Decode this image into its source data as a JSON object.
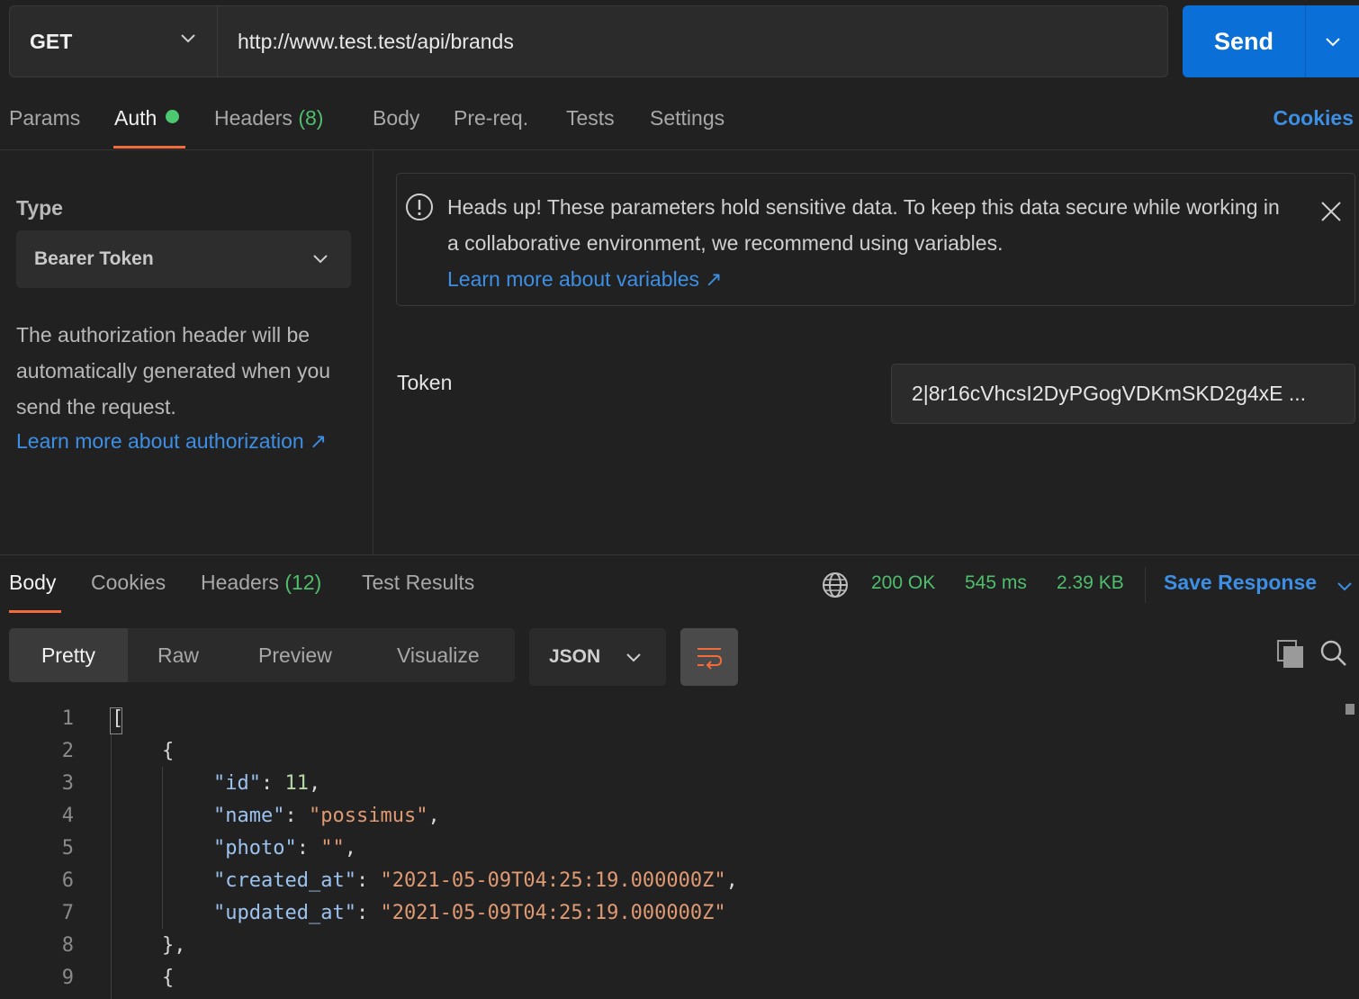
{
  "request": {
    "method": "GET",
    "url": "http://www.test.test/api/brands",
    "send_label": "Send"
  },
  "request_tabs": {
    "params": "Params",
    "auth": "Auth",
    "headers": "Headers",
    "headers_count": "(8)",
    "body": "Body",
    "prereq": "Pre-req.",
    "tests": "Tests",
    "settings": "Settings",
    "cookies": "Cookies"
  },
  "auth": {
    "type_label": "Type",
    "type_value": "Bearer Token",
    "description": "The authorization header will be automatically generated when you send the request.",
    "learn_more": "Learn more about authorization ↗",
    "warning_text": "Heads up! These parameters hold sensitive data. To keep this data secure while working in a collaborative environment, we recommend using variables.",
    "warning_link": "Learn more about variables ↗",
    "token_label": "Token",
    "token_value": "2|8r16cVhcsI2DyPGogVDKmSKD2g4xE ..."
  },
  "response_tabs": {
    "body": "Body",
    "cookies": "Cookies",
    "headers": "Headers",
    "headers_count": "(12)",
    "test_results": "Test Results",
    "status": "200 OK",
    "time": "545 ms",
    "size": "2.39 KB",
    "save_response": "Save Response"
  },
  "view": {
    "pretty": "Pretty",
    "raw": "Raw",
    "preview": "Preview",
    "visualize": "Visualize",
    "format": "JSON"
  },
  "code": {
    "line_numbers": [
      "1",
      "2",
      "3",
      "4",
      "5",
      "6",
      "7",
      "8",
      "9"
    ],
    "lines": {
      "l1": "[",
      "l2": "{",
      "id_key": "\"id\"",
      "id_val": "11",
      "name_key": "\"name\"",
      "name_val": "\"possimus\"",
      "photo_key": "\"photo\"",
      "photo_val": "\"\"",
      "created_key": "\"created_at\"",
      "created_val": "\"2021-05-09T04:25:19.000000Z\"",
      "updated_key": "\"updated_at\"",
      "updated_val": "\"2021-05-09T04:25:19.000000Z\"",
      "l8": "},",
      "l9": "{"
    }
  },
  "icons": {
    "method_dropdown": "chevron-down-icon",
    "send_dropdown": "chevron-down-icon",
    "warning": "alert-circle-icon",
    "close": "close-icon",
    "globe": "globe-icon",
    "copy": "copy-icon",
    "search": "search-icon",
    "wrap": "wrap-lines-icon"
  },
  "colors": {
    "accent_blue": "#0b6fd8",
    "link_blue": "#3d8fe5",
    "success_green": "#4fbe6d",
    "tab_underline": "#f26b3a"
  }
}
